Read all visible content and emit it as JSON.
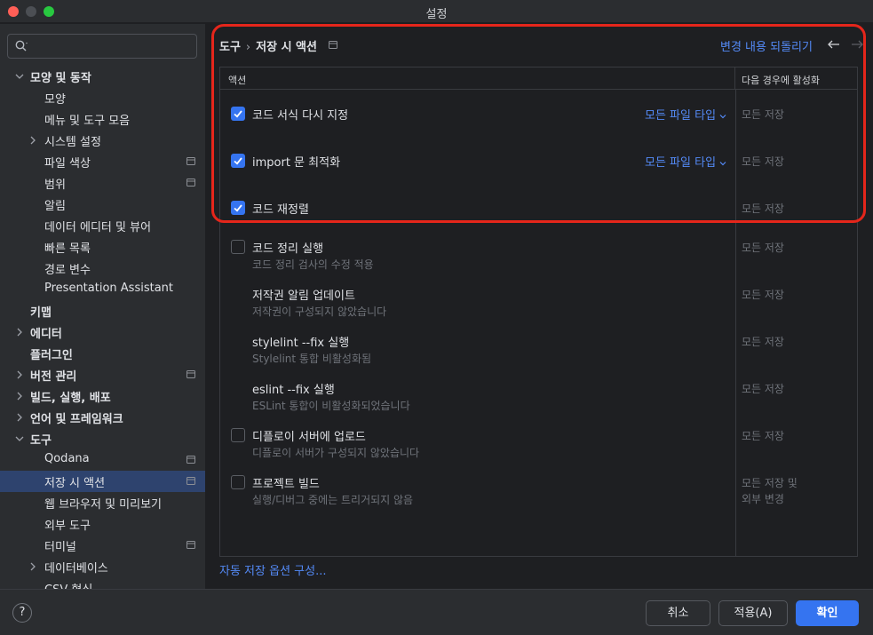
{
  "window": {
    "title": "설정"
  },
  "search": {
    "value": "",
    "placeholder": ""
  },
  "sidebar": {
    "items": [
      {
        "label": "모양 및 동작",
        "expanded": true,
        "bold": true
      },
      {
        "label": "모양"
      },
      {
        "label": "메뉴 및 도구 모음"
      },
      {
        "label": "시스템 설정",
        "expanded": false
      },
      {
        "label": "파일 색상",
        "project_scoped": true
      },
      {
        "label": "범위",
        "project_scoped": true
      },
      {
        "label": "알림"
      },
      {
        "label": "데이터 에디터 및 뷰어"
      },
      {
        "label": "빠른 목록"
      },
      {
        "label": "경로 변수"
      },
      {
        "label": "Presentation Assistant"
      },
      {
        "label": "키맵",
        "bold": true
      },
      {
        "label": "에디터",
        "expanded": false,
        "bold": true
      },
      {
        "label": "플러그인",
        "bold": true
      },
      {
        "label": "버전 관리",
        "expanded": false,
        "bold": true,
        "project_scoped": true
      },
      {
        "label": "빌드, 실행, 배포",
        "expanded": false,
        "bold": true
      },
      {
        "label": "언어 및 프레임워크",
        "expanded": false,
        "bold": true
      },
      {
        "label": "도구",
        "expanded": true,
        "bold": true
      },
      {
        "label": "Qodana",
        "project_scoped": true
      },
      {
        "label": "저장 시 액션",
        "selected": true,
        "project_scoped": true
      },
      {
        "label": "웹 브라우저 및 미리보기"
      },
      {
        "label": "외부 도구"
      },
      {
        "label": "터미널",
        "project_scoped": true
      },
      {
        "label": "데이터베이스",
        "expanded": false
      },
      {
        "label": "CSV 형식"
      }
    ]
  },
  "breadcrumb": {
    "parent": "도구",
    "current": "저장 시 액션",
    "separator": "›"
  },
  "revert_link": "변경 내용 되돌리기",
  "table": {
    "header_action": "액션",
    "header_when": "다음 경우에 활성화",
    "rows": [
      {
        "title": "코드 서식 다시 지정",
        "description": "",
        "checked": true,
        "checkbox": true,
        "filter": "모든 파일 타입",
        "when": "모든 저장"
      },
      {
        "title": "import 문 최적화",
        "description": "",
        "checked": true,
        "checkbox": true,
        "filter": "모든 파일 타입",
        "when": "모든 저장"
      },
      {
        "title": "코드 재정렬",
        "description": "",
        "checked": true,
        "checkbox": true,
        "filter": "",
        "when": "모든 저장"
      },
      {
        "title": "코드 정리 실행",
        "description": "코드 정리 검사의 수정 적용",
        "checked": false,
        "checkbox": true,
        "filter": "",
        "when": "모든 저장"
      },
      {
        "title": "저작권 알림 업데이트",
        "description": "저작권이 구성되지 않았습니다",
        "checked": false,
        "checkbox": false,
        "filter": "",
        "when": "모든 저장"
      },
      {
        "title": "stylelint --fix 실행",
        "description": "Stylelint 통합 비활성화됨",
        "checked": false,
        "checkbox": false,
        "filter": "",
        "when": "모든 저장"
      },
      {
        "title": "eslint --fix 실행",
        "description": "ESLint 통합이 비활성화되었습니다",
        "checked": false,
        "checkbox": false,
        "filter": "",
        "when": "모든 저장"
      },
      {
        "title": "디플로이 서버에 업로드",
        "description": "디플로이 서버가 구성되지 않았습니다",
        "checked": false,
        "checkbox": true,
        "filter": "",
        "when": "모든 저장"
      },
      {
        "title": "프로젝트 빌드",
        "description": "실행/디버그 중에는 트리거되지 않음",
        "checked": false,
        "checkbox": true,
        "filter": "",
        "when": "모든 저장 및\n외부 변경"
      }
    ]
  },
  "autosave_link": "자동 저장 옵션 구성...",
  "footer": {
    "help": "?",
    "cancel": "취소",
    "apply": "적용(A)",
    "ok": "확인"
  },
  "colors": {
    "accent": "#3574f0",
    "link": "#548af7",
    "highlight_border": "#e5261b",
    "selection": "#2e436e"
  }
}
